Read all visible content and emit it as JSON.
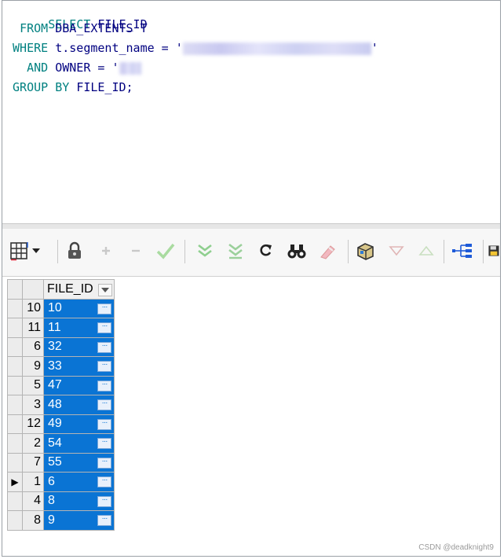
{
  "editor": {
    "l1_kw": "SELECT",
    "l1_rest": "FILE_ID",
    "l2_kw": "FROM",
    "l2_rest": "DBA_EXTENTS T",
    "l3_kw": "WHERE",
    "l3_rest": "t.segment_name =",
    "l3_quote_open": "'",
    "l3_quote_close": "'",
    "l4_kw": "AND",
    "l4_rest": "OWNER =",
    "l4_quote_open": "'",
    "l5_kw": "GROUP BY",
    "l5_rest": "FILE_ID;"
  },
  "toolbar": {
    "icons": [
      "grid-layout-icon",
      "lock-icon",
      "plus-icon",
      "minus-icon",
      "check-icon",
      "fetch-next-icon",
      "fetch-last-icon",
      "refresh-icon",
      "find-icon",
      "clear-icon",
      "export-icon",
      "filter-down-icon",
      "filter-up-icon",
      "tree-icon",
      "save-icon"
    ]
  },
  "grid": {
    "column_header": "FILE_ID",
    "current_row_marker": "▶",
    "rows": [
      {
        "num": "10",
        "value": "10",
        "current": false
      },
      {
        "num": "11",
        "value": "11",
        "current": false
      },
      {
        "num": "6",
        "value": "32",
        "current": false
      },
      {
        "num": "9",
        "value": "33",
        "current": false
      },
      {
        "num": "5",
        "value": "47",
        "current": false
      },
      {
        "num": "3",
        "value": "48",
        "current": false
      },
      {
        "num": "12",
        "value": "49",
        "current": false
      },
      {
        "num": "2",
        "value": "54",
        "current": false
      },
      {
        "num": "7",
        "value": "55",
        "current": false
      },
      {
        "num": "1",
        "value": "6",
        "current": true
      },
      {
        "num": "4",
        "value": "8",
        "current": false
      },
      {
        "num": "8",
        "value": "9",
        "current": false
      }
    ],
    "cell_button": "···"
  },
  "watermark": "CSDN @deadknight9",
  "colors": {
    "keyword": "#008080",
    "identifier": "#000080",
    "selection": "#0a74d4"
  }
}
